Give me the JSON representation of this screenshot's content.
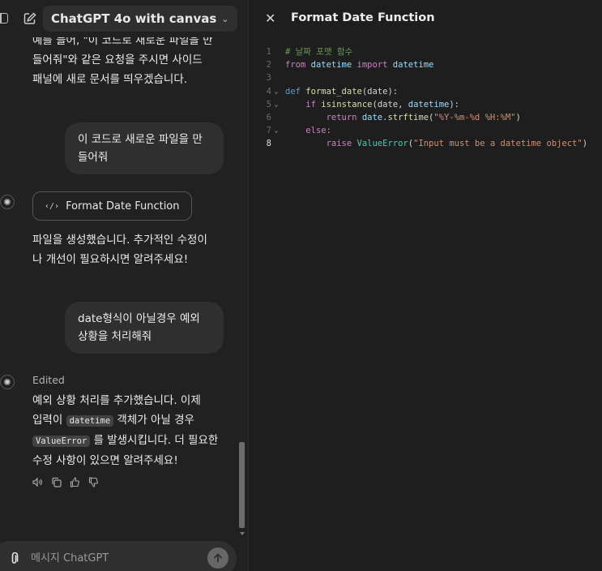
{
  "header": {
    "model_label": "ChatGPT 4o with canvas"
  },
  "messages": {
    "assistant1_lines": [
      "예를 들어, \"이 코드로 새로운 파일을 만",
      "들어줘\"와 같은 요청을 주시면 사이드",
      "패널에 새로 문서를 띄우겠습니다."
    ],
    "user1_lines": [
      "이 코드로 새로운 파일을 만",
      "들어줘"
    ],
    "doc_chip_label": "Format Date Function",
    "assistant2_lines": [
      "파일을 생성했습니다. 추가적인 수정이",
      "나 개선이 필요하시면 알려주세요!"
    ],
    "user2_lines": [
      "date형식이 아닐경우 예외",
      "상황을 처리해줘"
    ],
    "edited_label": "Edited",
    "assistant3": {
      "line1": "예외 상황 처리를 추가했습니다. 이제",
      "line2_pre": "입력이 ",
      "line2_code": "datetime",
      "line2_post": " 객체가 아닐 경우",
      "line3_code": "ValueError",
      "line3_post": " 를 발생시킵니다. 더 필요한",
      "line4": "수정 사항이 있으면 알려주세요!"
    }
  },
  "actions": {
    "icons": [
      "speaker-icon",
      "copy-icon",
      "thumbs-up-icon",
      "thumbs-down-icon"
    ]
  },
  "composer": {
    "placeholder": "메시지 ChatGPT"
  },
  "canvas": {
    "title": "Format Date Function",
    "active_line": 8,
    "code": [
      {
        "n": "1",
        "fold": ""
      },
      {
        "n": "2",
        "fold": ""
      },
      {
        "n": "3",
        "fold": ""
      },
      {
        "n": "4",
        "fold": "⌄"
      },
      {
        "n": "5",
        "fold": "⌄"
      },
      {
        "n": "6",
        "fold": ""
      },
      {
        "n": "7",
        "fold": "⌄"
      },
      {
        "n": "8",
        "fold": ""
      }
    ],
    "code_text": {
      "l1_comment": "# 날짜 포맷 함수",
      "l2_from": "from",
      "l2_mod": "datetime",
      "l2_import": "import",
      "l2_name": "datetime",
      "l4_def": "def",
      "l4_fn": "format_date",
      "l4_args": "(date):",
      "l5_if": "if",
      "l5_fn": "isinstance",
      "l5_args_a": "(date, ",
      "l5_args_b": "datetime",
      "l5_args_c": "):",
      "l6_return": "return",
      "l6_obj": "date.",
      "l6_fn": "strftime",
      "l6_str": "\"%Y-%m-%d %H:%M\"",
      "l7_else": "else:",
      "l8_raise": "raise",
      "l8_cls": "ValueError",
      "l8_str": "\"Input must be a datetime object\""
    }
  },
  "colors": {
    "background": "#212121",
    "canvas_background": "#1e1e1e",
    "bubble": "#2f2f2f"
  }
}
